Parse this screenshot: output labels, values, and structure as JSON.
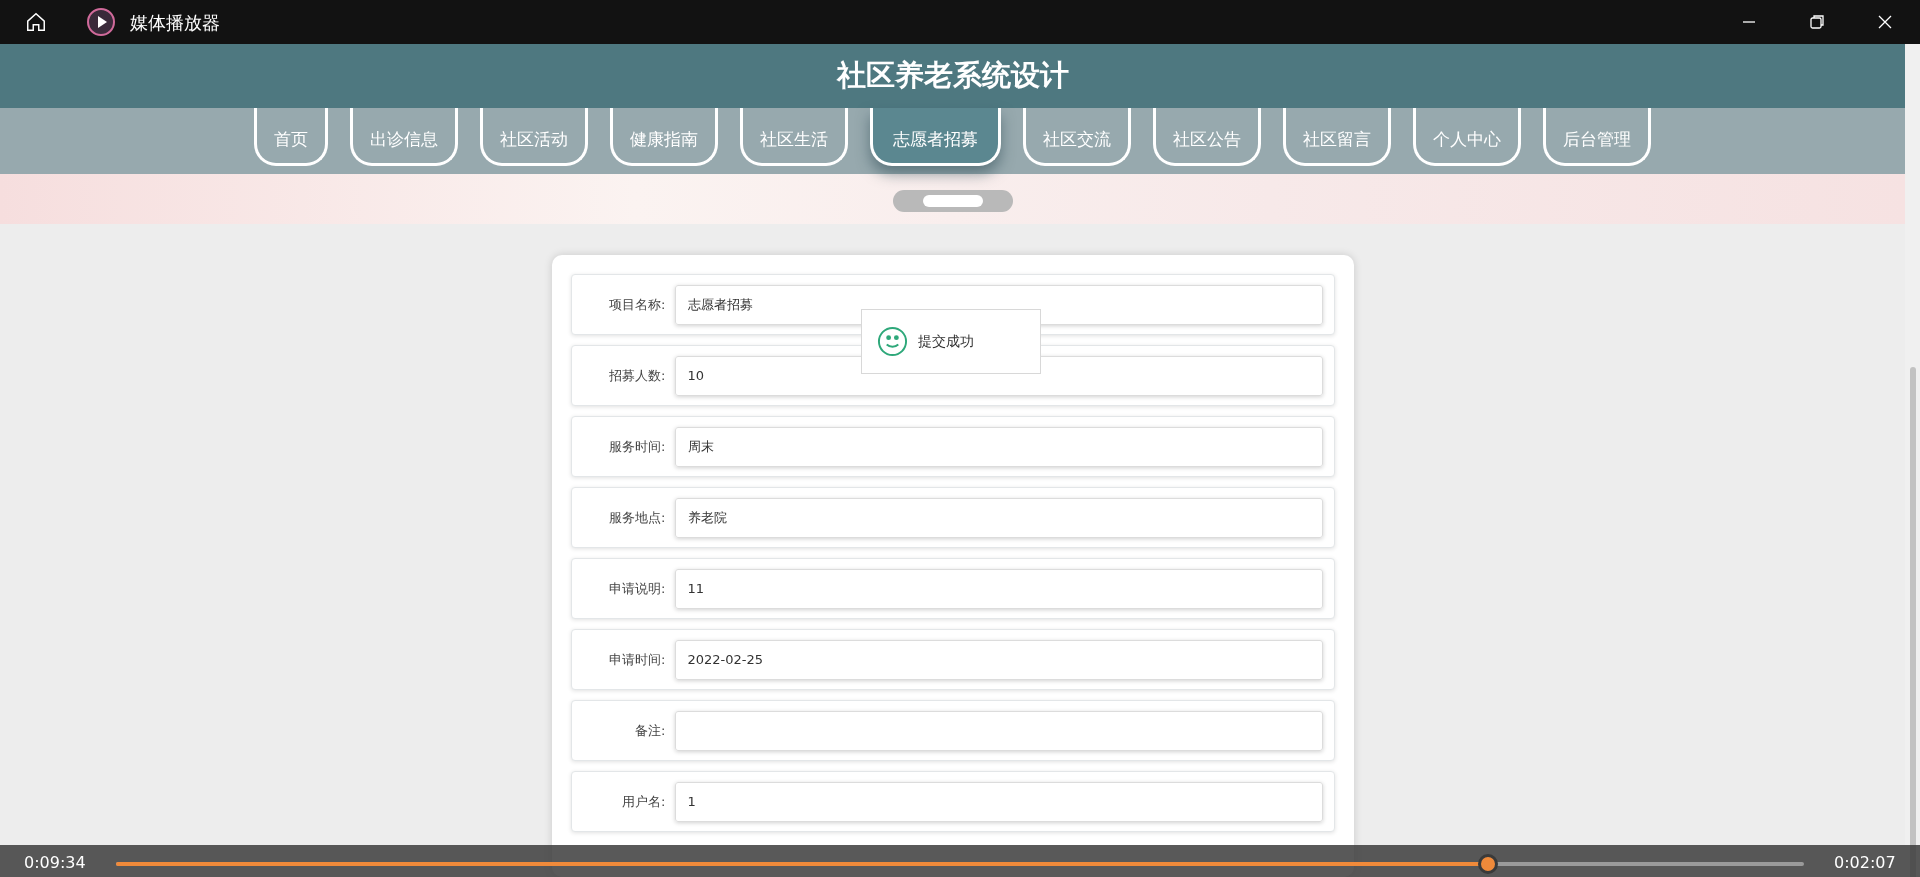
{
  "window": {
    "title": "媒体播放器"
  },
  "site": {
    "title": "社区养老系统设计"
  },
  "nav": [
    {
      "label": "首页",
      "selected": false
    },
    {
      "label": "出诊信息",
      "selected": false
    },
    {
      "label": "社区活动",
      "selected": false
    },
    {
      "label": "健康指南",
      "selected": false
    },
    {
      "label": "社区生活",
      "selected": false
    },
    {
      "label": "志愿者招募",
      "selected": true
    },
    {
      "label": "社区交流",
      "selected": false
    },
    {
      "label": "社区公告",
      "selected": false
    },
    {
      "label": "社区留言",
      "selected": false
    },
    {
      "label": "个人中心",
      "selected": false
    },
    {
      "label": "后台管理",
      "selected": false
    }
  ],
  "form": [
    {
      "label": "项目名称:",
      "value": "志愿者招募"
    },
    {
      "label": "招募人数:",
      "value": "10"
    },
    {
      "label": "服务时间:",
      "value": "周末"
    },
    {
      "label": "服务地点:",
      "value": "养老院"
    },
    {
      "label": "申请说明:",
      "value": "11"
    },
    {
      "label": "申请时间:",
      "value": "2022-02-25"
    },
    {
      "label": "备注:"
    },
    {
      "label": "用户名:",
      "value": "1"
    }
  ],
  "toast": {
    "message": "提交成功"
  },
  "player": {
    "elapsed": "0:09:34",
    "remaining": "0:02:07",
    "level": 0.813
  }
}
